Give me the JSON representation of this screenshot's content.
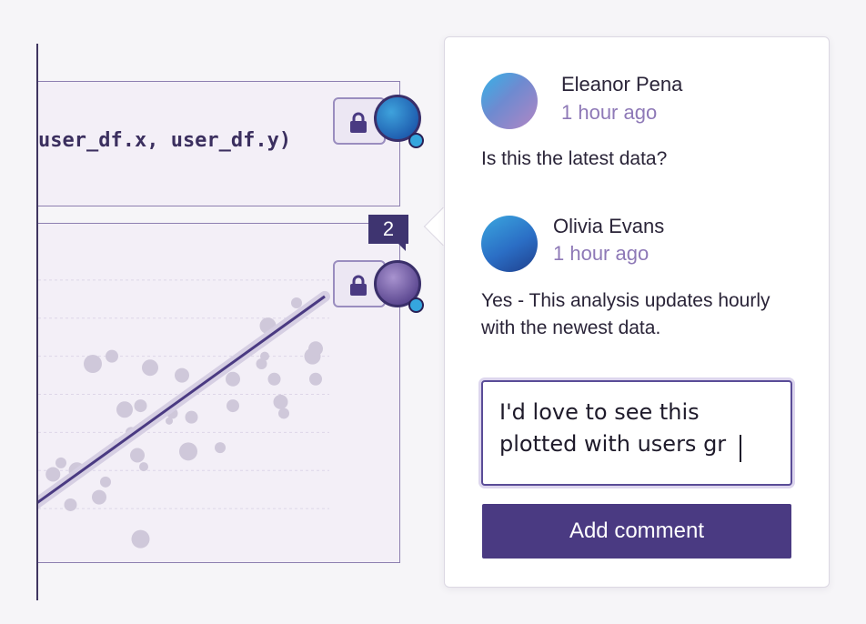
{
  "notebook": {
    "code_cell": {
      "code_text": "user_df.x, user_df.y)"
    },
    "chart_cell": {
      "comment_count": "2"
    }
  },
  "comments_panel": {
    "comments": [
      {
        "author": "Eleanor Pena",
        "time": "1 hour ago",
        "text": "Is this the latest data?"
      },
      {
        "author": "Olivia Evans",
        "time": "1 hour ago",
        "text": "Yes - This analysis updates hourly with the newest data."
      }
    ],
    "draft_comment": "I'd love to see this plotted with users gr",
    "add_button_label": "Add comment"
  },
  "colors": {
    "accent": "#4a3a82",
    "timestamp": "#8e79b7",
    "scatter_point": "#cfc8da",
    "trend_line": "#4a3a82"
  },
  "icons": [
    "lock-icon",
    "lock-icon",
    "user-presence-avatar",
    "status-dot"
  ],
  "chart_data": {
    "type": "scatter",
    "title": "",
    "xlabel": "",
    "ylabel": "",
    "grid": true,
    "points": [
      [
        0.75,
        1.9
      ],
      [
        1.0,
        2.2
      ],
      [
        1.5,
        2.0
      ],
      [
        1.3,
        1.1
      ],
      [
        2.2,
        1.3
      ],
      [
        2.4,
        1.7
      ],
      [
        2.0,
        4.8
      ],
      [
        2.6,
        5.0
      ],
      [
        3.0,
        3.6
      ],
      [
        3.2,
        3.0
      ],
      [
        3.4,
        2.4
      ],
      [
        3.6,
        2.1
      ],
      [
        3.5,
        3.7
      ],
      [
        3.8,
        4.7
      ],
      [
        4.5,
        3.5
      ],
      [
        4.8,
        4.5
      ],
      [
        5.1,
        3.4
      ],
      [
        5.0,
        2.5
      ],
      [
        6.0,
        2.6
      ],
      [
        6.4,
        4.4
      ],
      [
        6.4,
        3.7
      ],
      [
        7.3,
        4.8
      ],
      [
        7.5,
        5.8
      ],
      [
        7.7,
        4.4
      ],
      [
        7.9,
        3.8
      ],
      [
        8.0,
        3.5
      ],
      [
        8.9,
        5.0
      ],
      [
        9.0,
        4.4
      ],
      [
        8.4,
        6.4
      ],
      [
        7.4,
        5.0
      ],
      [
        3.5,
        0.2
      ],
      [
        4.4,
        3.3
      ],
      [
        9.0,
        5.2
      ],
      [
        2.8,
        2.7
      ]
    ],
    "trend_line": {
      "x": [
        0.0,
        10.0
      ],
      "y": [
        1.0,
        7.0
      ]
    }
  }
}
